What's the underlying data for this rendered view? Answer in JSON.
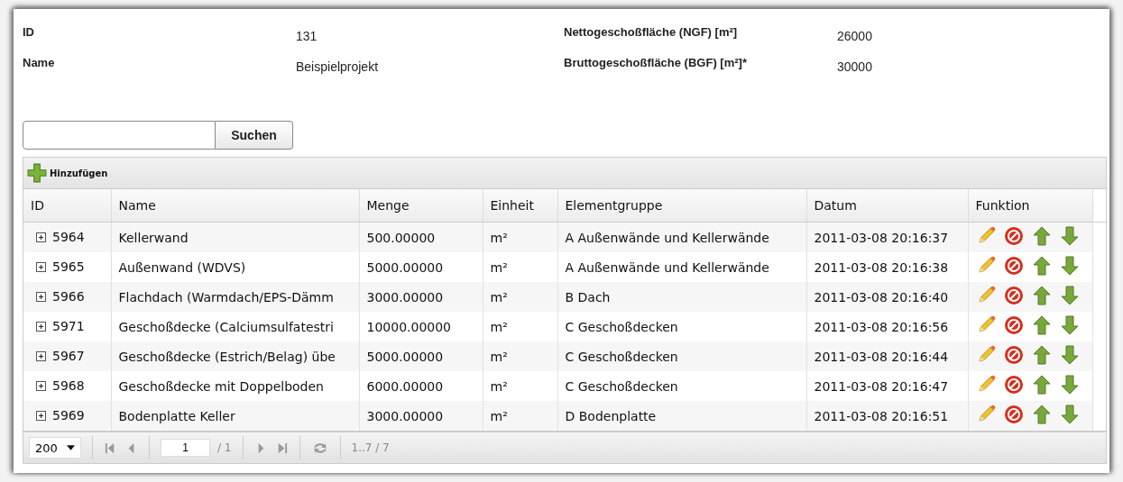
{
  "project": {
    "fields": [
      {
        "label": "ID",
        "value": "131"
      },
      {
        "label": "Nettogeschoßfläche (NGF) [m²]",
        "value": "26000"
      },
      {
        "label": "Name",
        "value": "Beispielprojekt"
      },
      {
        "label": "Bruttogeschoßfläche (BGF) [m²]*",
        "value": "30000"
      }
    ]
  },
  "search": {
    "button": "Suchen"
  },
  "grid": {
    "toolbar": {
      "add": "Hinzufügen"
    },
    "columns": [
      "ID",
      "Name",
      "Menge",
      "Einheit",
      "Elementgruppe",
      "Datum",
      "Funktion"
    ],
    "rows": [
      {
        "id": "5964",
        "name": "Kellerwand",
        "menge": "500.00000",
        "einheit": "m²",
        "gruppe": "A Außenwände und Kellerwände",
        "datum": "2011-03-08 20:16:37"
      },
      {
        "id": "5965",
        "name": "Außenwand (WDVS)",
        "menge": "5000.00000",
        "einheit": "m²",
        "gruppe": "A Außenwände und Kellerwände",
        "datum": "2011-03-08 20:16:38"
      },
      {
        "id": "5966",
        "name": "Flachdach (Warmdach/EPS-Dämm",
        "menge": "3000.00000",
        "einheit": "m²",
        "gruppe": "B Dach",
        "datum": "2011-03-08 20:16:40"
      },
      {
        "id": "5971",
        "name": "Geschoßdecke (Calciumsulfatestri",
        "menge": "10000.00000",
        "einheit": "m²",
        "gruppe": "C Geschoßdecken",
        "datum": "2011-03-08 20:16:56"
      },
      {
        "id": "5967",
        "name": "Geschoßdecke (Estrich/Belag) übe",
        "menge": "5000.00000",
        "einheit": "m²",
        "gruppe": "C Geschoßdecken",
        "datum": "2011-03-08 20:16:44"
      },
      {
        "id": "5968",
        "name": "Geschoßdecke mit Doppelboden",
        "menge": "6000.00000",
        "einheit": "m²",
        "gruppe": "C Geschoßdecken",
        "datum": "2011-03-08 20:16:47"
      },
      {
        "id": "5969",
        "name": "Bodenplatte Keller",
        "menge": "3000.00000",
        "einheit": "m²",
        "gruppe": "D Bodenplatte",
        "datum": "2011-03-08 20:16:51"
      }
    ],
    "pager": {
      "page_size": "200",
      "page": "1",
      "page_total": "/ 1",
      "range": "1..7 / 7"
    }
  }
}
